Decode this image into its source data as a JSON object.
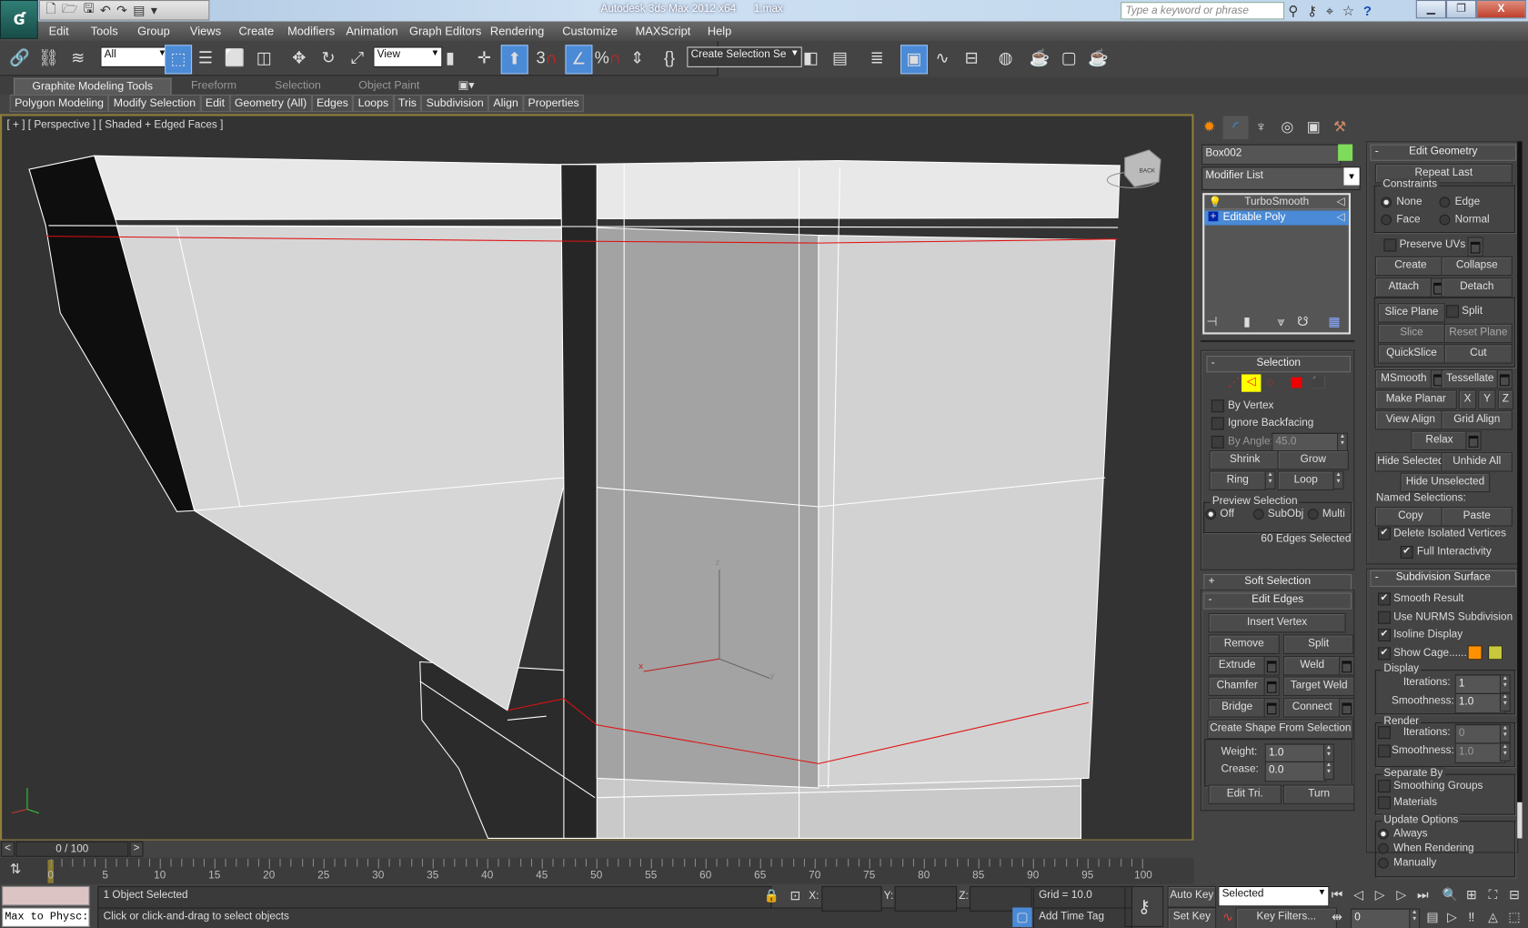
{
  "title_bar": {
    "app_title": "Autodesk 3ds Max  2012 x64",
    "file_name": "1.max",
    "search_placeholder": "Type a keyword or phrase",
    "app_logo": "3ds-max-logo"
  },
  "menu": [
    "Edit",
    "Tools",
    "Group",
    "Views",
    "Create",
    "Modifiers",
    "Animation",
    "Graph Editors",
    "Rendering",
    "Customize",
    "MAXScript",
    "Help"
  ],
  "toolbar": {
    "selection_filter": "All",
    "reference_coord": "View",
    "snap_toggle": "3",
    "percent_snap": "%",
    "named_selection": "Create Selection Se"
  },
  "ribbon": {
    "tabs": [
      "Graphite Modeling Tools",
      "Freeform",
      "Selection",
      "Object Paint"
    ],
    "panels": [
      "Polygon Modeling",
      "Modify Selection",
      "Edit",
      "Geometry (All)",
      "Edges",
      "Loops",
      "Tris",
      "Subdivision",
      "Align",
      "Properties"
    ]
  },
  "viewport": {
    "label_plus": "[ + ]",
    "label_view": "[ Perspective ]",
    "label_shading": "[ Shaded + Edged Faces ]",
    "viewcube_face": "BACK",
    "axis_x": "x",
    "axis_y": "y",
    "axis_z": "z"
  },
  "command_panel": {
    "object_name": "Box002",
    "object_color": "#7fdc5a",
    "modifier_list": "Modifier List",
    "stack": [
      {
        "label": "TurboSmooth",
        "selected": false
      },
      {
        "label": "Editable Poly",
        "selected": true
      }
    ],
    "selection": {
      "title": "Selection",
      "by_vertex": "By Vertex",
      "ignore_backfacing": "Ignore Backfacing",
      "by_angle": "By Angle:",
      "angle_value": "45.0",
      "shrink": "Shrink",
      "grow": "Grow",
      "ring": "Ring",
      "loop": "Loop",
      "preview_title": "Preview Selection",
      "preview_options": [
        "Off",
        "SubObj",
        "Multi"
      ],
      "preview_selected": "Off",
      "status": "60 Edges Selected"
    },
    "soft_selection": {
      "title": "Soft Selection"
    },
    "edit_edges": {
      "title": "Edit Edges",
      "insert_vertex": "Insert Vertex",
      "remove": "Remove",
      "split": "Split",
      "extrude": "Extrude",
      "weld": "Weld",
      "chamfer": "Chamfer",
      "target_weld": "Target Weld",
      "bridge": "Bridge",
      "connect": "Connect",
      "create_shape": "Create Shape From Selection",
      "weight_label": "Weight:",
      "weight": "1.0",
      "crease_label": "Crease:",
      "crease": "0.0",
      "edit_tri": "Edit Tri.",
      "turn": "Turn"
    },
    "edit_geometry": {
      "title": "Edit Geometry",
      "repeat_last": "Repeat Last",
      "constraints_title": "Constraints",
      "constraints": [
        "None",
        "Edge",
        "Face",
        "Normal"
      ],
      "constraint_selected": "None",
      "preserve_uvs": "Preserve UVs",
      "create": "Create",
      "collapse": "Collapse",
      "attach": "Attach",
      "detach": "Detach",
      "slice_plane": "Slice Plane",
      "split": "Split",
      "slice": "Slice",
      "reset_plane": "Reset Plane",
      "quickslice": "QuickSlice",
      "cut": "Cut",
      "msmooth": "MSmooth",
      "tessellate": "Tessellate",
      "make_planar": "Make Planar",
      "x": "X",
      "y": "Y",
      "z": "Z",
      "view_align": "View Align",
      "grid_align": "Grid Align",
      "relax": "Relax",
      "hide_selected": "Hide Selected",
      "unhide_all": "Unhide All",
      "hide_unselected": "Hide Unselected",
      "named_selections": "Named Selections:",
      "copy": "Copy",
      "paste": "Paste",
      "delete_isolated": "Delete Isolated Vertices",
      "delete_isolated_checked": true,
      "full_interactivity": "Full Interactivity",
      "full_interactivity_checked": true
    },
    "subdivision": {
      "title": "Subdivision Surface",
      "smooth_result": "Smooth Result",
      "use_nurms": "Use NURMS Subdivision",
      "isoline": "Isoline Display",
      "show_cage": "Show Cage......",
      "cage_color_1": "#ff9000",
      "cage_color_2": "#c8c83c",
      "display_title": "Display",
      "iterations_label": "Iterations:",
      "display_iterations": "1",
      "smoothness_label": "Smoothness:",
      "display_smoothness": "1.0",
      "render_title": "Render",
      "render_iterations": "0",
      "render_smoothness": "1.0",
      "separate_title": "Separate By",
      "smoothing_groups": "Smoothing Groups",
      "materials": "Materials",
      "update_title": "Update Options",
      "update_options": [
        "Always",
        "When Rendering",
        "Manually"
      ],
      "update_selected": "Always"
    }
  },
  "timeline": {
    "prev": "<",
    "next": ">",
    "position": "0 / 100",
    "current_frame": 0,
    "tick_labels": [
      0,
      5,
      10,
      15,
      20,
      25,
      30,
      35,
      40,
      45,
      50,
      55,
      60,
      65,
      70,
      75,
      80,
      85,
      90,
      95,
      100
    ]
  },
  "status": {
    "maxscript_listener": "Max to Physc:",
    "selection_status": "1 Object Selected",
    "prompt": "Click or click-and-drag to select objects",
    "x_label": "X:",
    "y_label": "Y:",
    "z_label": "Z:",
    "x": "",
    "y": "",
    "z": "",
    "grid": "Grid = 10.0",
    "add_time_tag": "Add Time Tag",
    "auto_key": "Auto Key",
    "set_key": "Set Key",
    "key_mode": "Selected",
    "key_filters": "Key Filters...",
    "frame": "0"
  },
  "colors": {
    "viewport_border": "#8e7d3c",
    "selection_highlight": "#4a8ad6",
    "selected_edges": "#e01010"
  }
}
